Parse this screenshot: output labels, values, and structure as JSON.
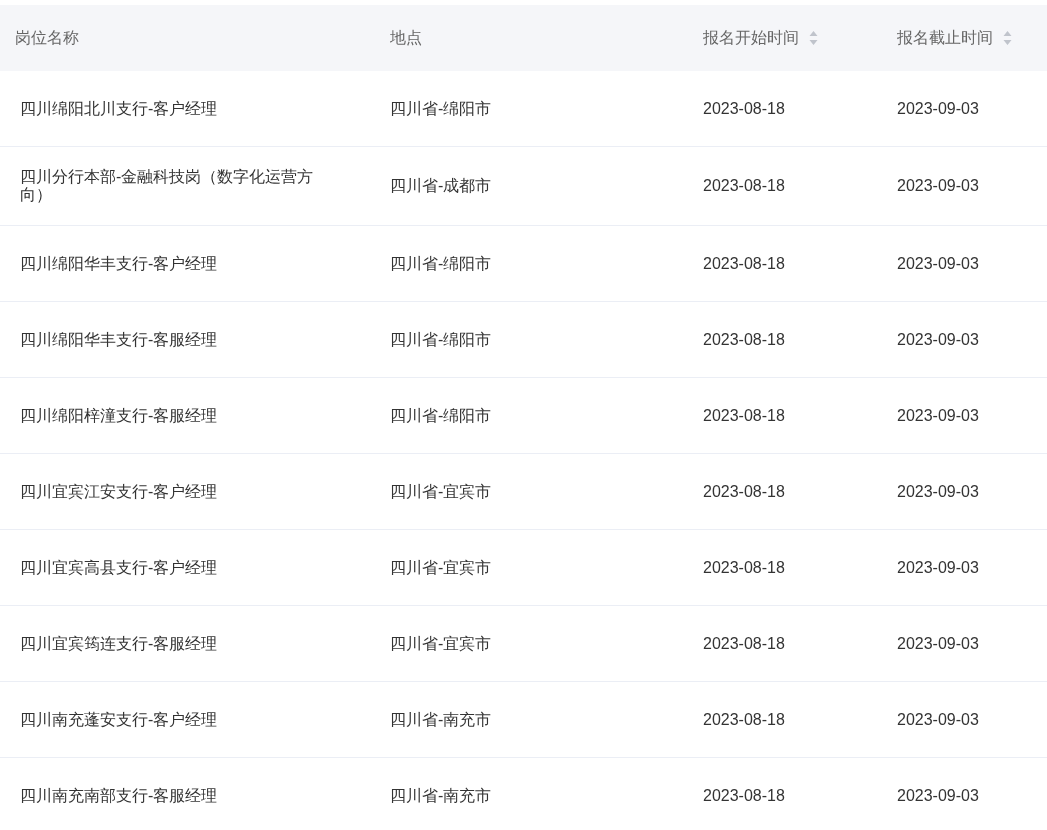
{
  "table": {
    "columns": [
      {
        "label": "岗位名称",
        "sortable": false
      },
      {
        "label": "地点",
        "sortable": false
      },
      {
        "label": "报名开始时间",
        "sortable": true
      },
      {
        "label": "报名截止时间",
        "sortable": true
      }
    ],
    "rows": [
      [
        "四川绵阳北川支行-客户经理",
        "四川省-绵阳市",
        "2023-08-18",
        "2023-09-03"
      ],
      [
        "四川分行本部-金融科技岗（数字化运营方向）",
        "四川省-成都市",
        "2023-08-18",
        "2023-09-03"
      ],
      [
        "四川绵阳华丰支行-客户经理",
        "四川省-绵阳市",
        "2023-08-18",
        "2023-09-03"
      ],
      [
        "四川绵阳华丰支行-客服经理",
        "四川省-绵阳市",
        "2023-08-18",
        "2023-09-03"
      ],
      [
        "四川绵阳梓潼支行-客服经理",
        "四川省-绵阳市",
        "2023-08-18",
        "2023-09-03"
      ],
      [
        "四川宜宾江安支行-客户经理",
        "四川省-宜宾市",
        "2023-08-18",
        "2023-09-03"
      ],
      [
        "四川宜宾高县支行-客户经理",
        "四川省-宜宾市",
        "2023-08-18",
        "2023-09-03"
      ],
      [
        "四川宜宾筠连支行-客服经理",
        "四川省-宜宾市",
        "2023-08-18",
        "2023-09-03"
      ],
      [
        "四川南充蓬安支行-客户经理",
        "四川省-南充市",
        "2023-08-18",
        "2023-09-03"
      ],
      [
        "四川南充南部支行-客服经理",
        "四川省-南充市",
        "2023-08-18",
        "2023-09-03"
      ]
    ]
  }
}
